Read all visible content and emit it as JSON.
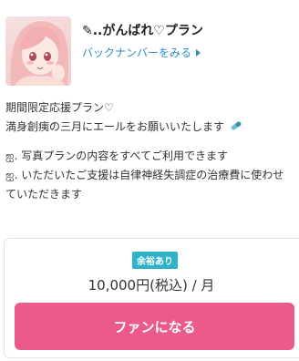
{
  "plan": {
    "title": "✎..がんばれ♡プラン",
    "backnumber_link": "バックナンバーをみる",
    "thumbnail_alt": "anime girl illustration"
  },
  "description": {
    "line1": "期間限定応援プラン♡",
    "line2": "満身創痍の三月にエールをお願いいたします",
    "line3": "ஐ. 写真プランの内容をすべてご利用できます",
    "line4": "ஐ. いただいたご支援は自律神経失調症の治療費に使わせ",
    "line5": "ていただきます"
  },
  "card": {
    "badge": "余裕あり",
    "price": "10,000円(税込) / 月",
    "button": "ファンになる"
  },
  "colors": {
    "accent_pink": "#ec5a8c",
    "link_blue": "#2f8ec4",
    "badge_teal": "#2eb3c9"
  },
  "icons": {
    "caret": "caret-right-icon",
    "pills": "pill-capsule-icon"
  }
}
